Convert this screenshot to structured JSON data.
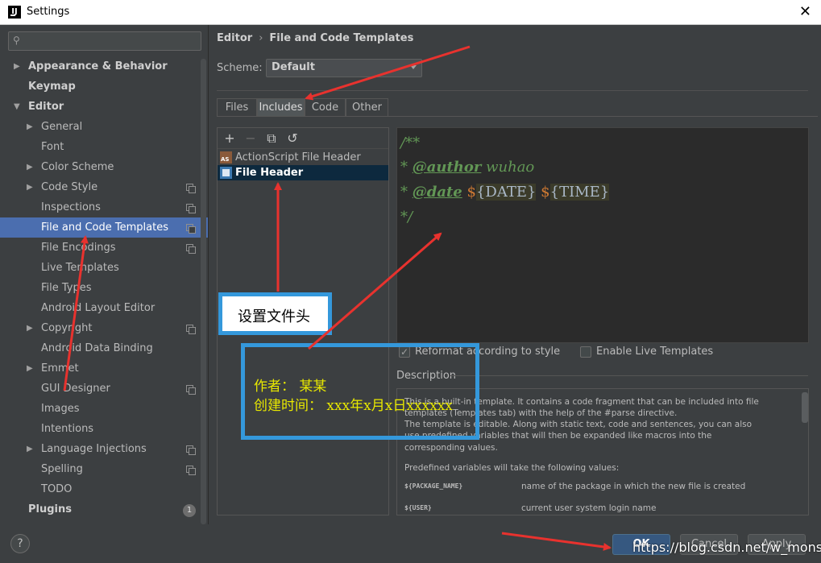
{
  "window": {
    "title": "Settings"
  },
  "search": {
    "placeholder": ""
  },
  "sidebar": {
    "items": [
      {
        "label": "Appearance & Behavior",
        "level": 0,
        "arrow": "right"
      },
      {
        "label": "Keymap",
        "level": 0
      },
      {
        "label": "Editor",
        "level": 0,
        "arrow": "down"
      },
      {
        "label": "General",
        "level": 1,
        "arrow": "right"
      },
      {
        "label": "Font",
        "level": 1
      },
      {
        "label": "Color Scheme",
        "level": 1,
        "arrow": "right"
      },
      {
        "label": "Code Style",
        "level": 1,
        "arrow": "right",
        "icon": "copy"
      },
      {
        "label": "Inspections",
        "level": 1,
        "icon": "copy"
      },
      {
        "label": "File and Code Templates",
        "level": 1,
        "icon": "copy",
        "selected": true
      },
      {
        "label": "File Encodings",
        "level": 1,
        "icon": "copy"
      },
      {
        "label": "Live Templates",
        "level": 1
      },
      {
        "label": "File Types",
        "level": 1
      },
      {
        "label": "Android Layout Editor",
        "level": 1
      },
      {
        "label": "Copyright",
        "level": 1,
        "arrow": "right",
        "icon": "copy"
      },
      {
        "label": "Android Data Binding",
        "level": 1
      },
      {
        "label": "Emmet",
        "level": 1,
        "arrow": "right"
      },
      {
        "label": "GUI Designer",
        "level": 1,
        "icon": "copy"
      },
      {
        "label": "Images",
        "level": 1
      },
      {
        "label": "Intentions",
        "level": 1
      },
      {
        "label": "Language Injections",
        "level": 1,
        "arrow": "right",
        "icon": "copy"
      },
      {
        "label": "Spelling",
        "level": 1,
        "icon": "copy"
      },
      {
        "label": "TODO",
        "level": 1
      },
      {
        "label": "Plugins",
        "level": 0,
        "badge": "1"
      }
    ]
  },
  "breadcrumb": {
    "parent": "Editor",
    "separator": "›",
    "current": "File and Code Templates"
  },
  "scheme": {
    "label": "Scheme:",
    "value": "Default"
  },
  "tabs": [
    {
      "label": "Files"
    },
    {
      "label": "Includes",
      "active": true
    },
    {
      "label": "Code"
    },
    {
      "label": "Other"
    }
  ],
  "toolbar": {
    "add": "+",
    "remove": "−",
    "copy": "⧉",
    "reset": "↺"
  },
  "templates": [
    {
      "label": "ActionScript File Header",
      "icon": "actionscript-file-icon"
    },
    {
      "label": "File Header",
      "icon": "file-header-icon",
      "selected": true
    }
  ],
  "editor": {
    "line1": "/**",
    "line2_star": "* ",
    "line2_tag": "@author",
    "line2_val": " wuhao",
    "line3_star": "* ",
    "line3_tag": "@date",
    "line3_d1": " $",
    "line3_v1": "{DATE}",
    "line3_d2": " $",
    "line3_v2": "{TIME}",
    "line4": "*/"
  },
  "options": {
    "reformat": "Reformat according to style",
    "live_templates": "Enable Live Templates"
  },
  "description": {
    "title": "Description",
    "p1_a": "This is a built-in template. It contains a code fragment that can be included into file",
    "p1_b": "templates (Templates tab) with the help of the #parse directive.",
    "p1_c": "The template is editable. Along with static text, code and sentences, you can also",
    "p1_d": "use predefined variables that will then be expanded like macros into the",
    "p1_e": "corresponding values.",
    "p2": "Predefined variables will take the following values:",
    "vars": [
      {
        "name": "${PACKAGE_NAME}",
        "desc": "name of the package in which the new file is created"
      },
      {
        "name": "${USER}",
        "desc": "current user system login name"
      }
    ]
  },
  "buttons": {
    "help": "?",
    "ok": "OK",
    "cancel": "Cancel",
    "apply": "Apply"
  },
  "annotations": {
    "box1": "设置文件头",
    "box2_line1": "作者：  某某",
    "box2_line2": "创建时间：  xxx年x月x日xxxxxx"
  },
  "watermark": "https://blog.csdn.net/w_monster",
  "colors": {
    "selection": "#4b6eaf",
    "annotation_arrow": "#e8322e",
    "annotation_box": "#3498db",
    "primary_button": "#365880"
  }
}
